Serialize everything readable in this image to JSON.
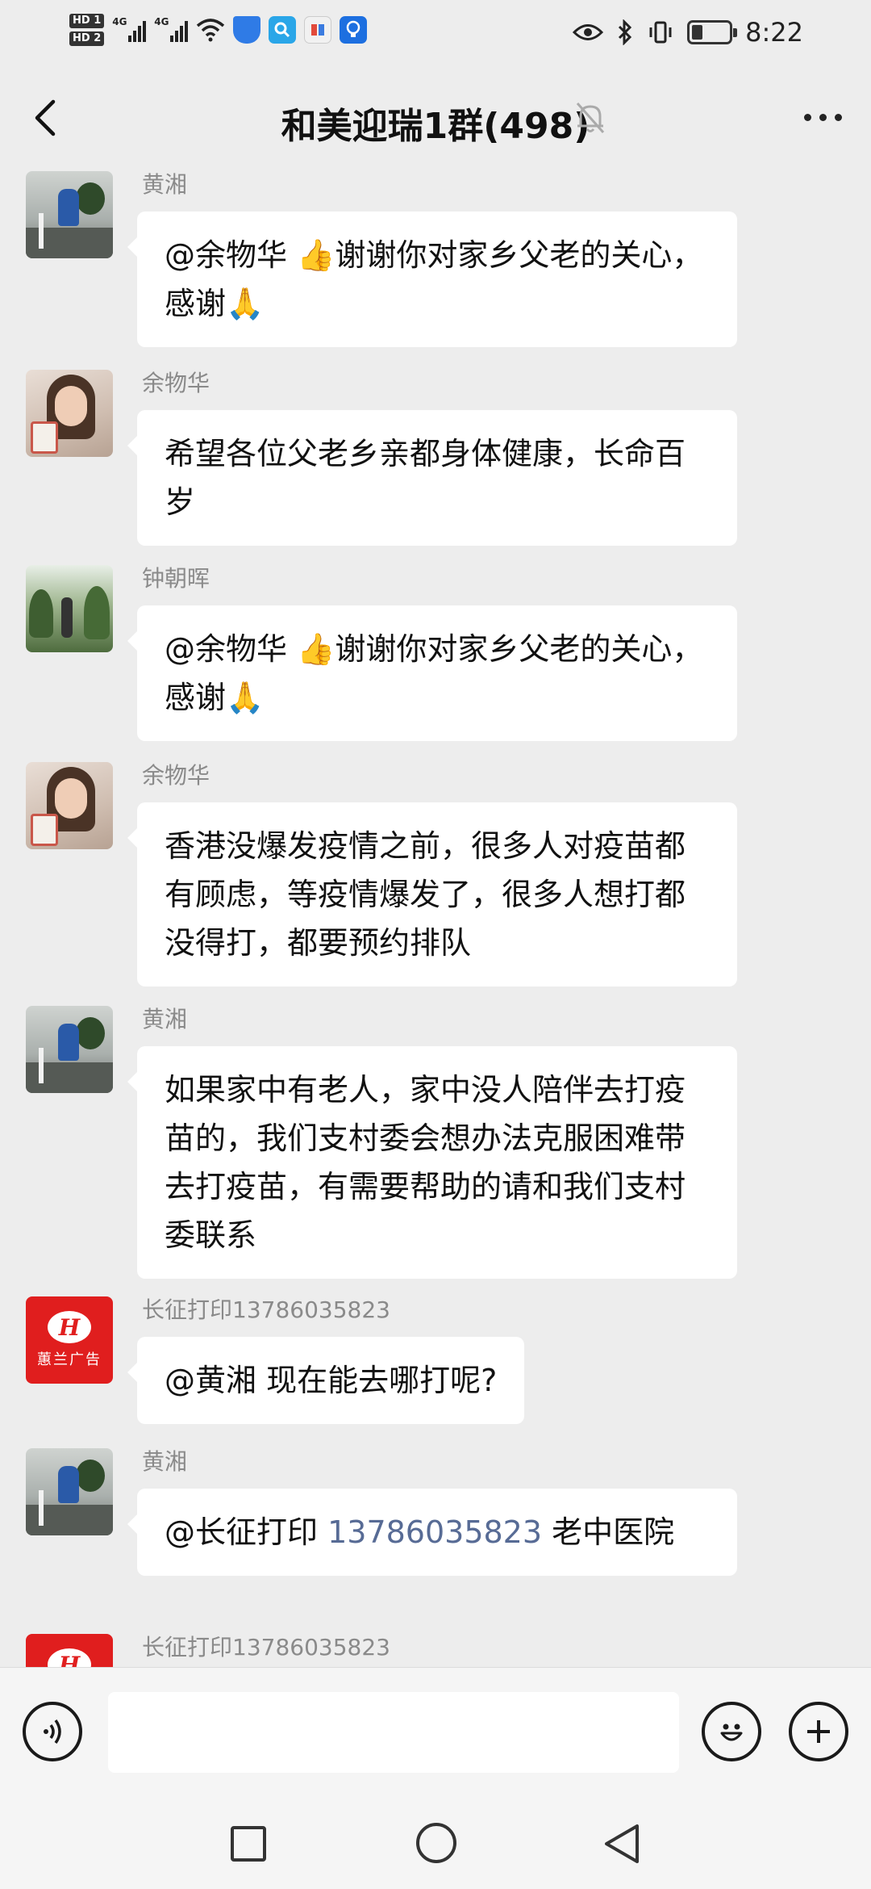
{
  "status_bar": {
    "time": "8:22",
    "hd1": "HD 1",
    "hd2": "HD 2",
    "network1": "4G",
    "network2": "4G",
    "battery_level": 0.3
  },
  "header": {
    "title": "和美迎瑞1群(498)",
    "muted": true
  },
  "messages": [
    {
      "sender": "黄湘",
      "avatar": "mountain",
      "text": "@余物华 👍谢谢你对家乡父老的关心，感谢🙏"
    },
    {
      "sender": "余物华",
      "avatar": "woman",
      "text": "希望各位父老乡亲都身体健康，长命百岁"
    },
    {
      "sender": "钟朝晖",
      "avatar": "forest",
      "text": "@余物华 👍谢谢你对家乡父老的关心，感谢🙏"
    },
    {
      "sender": "余物华",
      "avatar": "woman",
      "text": "香港没爆发疫情之前，很多人对疫苗都有顾虑，等疫情爆发了，很多人想打都没得打，都要预约排队"
    },
    {
      "sender": "黄湘",
      "avatar": "mountain",
      "text": "如果家中有老人，家中没人陪伴去打疫苗的，我们支村委会想办法克服困难带去打疫苗，有需要帮助的请和我们支村委联系"
    },
    {
      "sender": "长征打印13786035823",
      "avatar": "logo",
      "text": "@黄湘  现在能去哪打呢?"
    },
    {
      "sender": "黄湘",
      "avatar": "mountain",
      "text_prefix": "@长征打印 ",
      "phone": "13786035823",
      "text_suffix": " 老中医院"
    },
    {
      "sender": "长征打印13786035823",
      "avatar": "logo"
    }
  ],
  "logo_avatar": {
    "mark": "H",
    "brand": "蕙兰广告"
  },
  "input": {
    "placeholder": ""
  }
}
